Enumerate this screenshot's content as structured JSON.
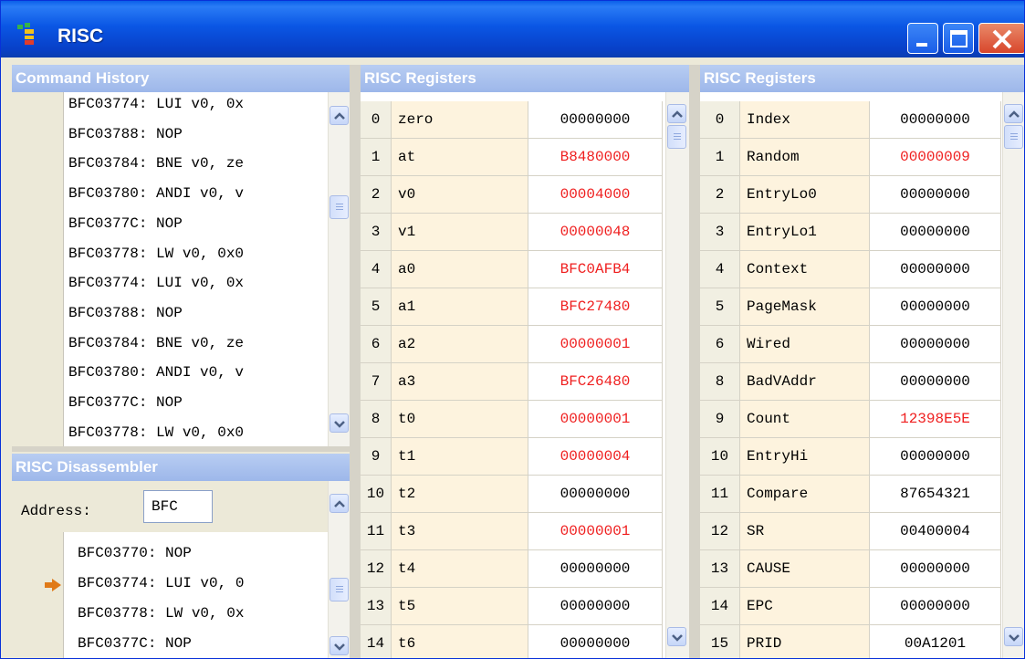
{
  "window": {
    "title": "RISC"
  },
  "command_history": {
    "title": "Command History",
    "lines": [
      "BFC03774: LUI v0, 0x",
      "BFC03788: NOP",
      "BFC03784: BNE v0, ze",
      "BFC03780: ANDI v0, v",
      "BFC0377C: NOP",
      "BFC03778: LW v0, 0x0",
      "BFC03774: LUI v0, 0x",
      "BFC03788: NOP",
      "BFC03784: BNE v0, ze",
      "BFC03780: ANDI v0, v",
      "BFC0377C: NOP",
      "BFC03778: LW v0, 0x0"
    ]
  },
  "disassembler": {
    "title": "RISC Disassembler",
    "address_label": "Address:",
    "address_value": "BFC",
    "current_line_index": 1,
    "lines": [
      "BFC03770: NOP",
      "BFC03774: LUI v0, 0",
      "BFC03778: LW v0, 0x",
      "BFC0377C: NOP"
    ]
  },
  "gpr_panel": {
    "title": "RISC Registers",
    "rows": [
      {
        "idx": "0",
        "name": "zero",
        "value": "00000000",
        "changed": false
      },
      {
        "idx": "1",
        "name": "at",
        "value": "B8480000",
        "changed": true
      },
      {
        "idx": "2",
        "name": "v0",
        "value": "00004000",
        "changed": true
      },
      {
        "idx": "3",
        "name": "v1",
        "value": "00000048",
        "changed": true
      },
      {
        "idx": "4",
        "name": "a0",
        "value": "BFC0AFB4",
        "changed": true
      },
      {
        "idx": "5",
        "name": "a1",
        "value": "BFC27480",
        "changed": true
      },
      {
        "idx": "6",
        "name": "a2",
        "value": "00000001",
        "changed": true
      },
      {
        "idx": "7",
        "name": "a3",
        "value": "BFC26480",
        "changed": true
      },
      {
        "idx": "8",
        "name": "t0",
        "value": "00000001",
        "changed": true
      },
      {
        "idx": "9",
        "name": "t1",
        "value": "00000004",
        "changed": true
      },
      {
        "idx": "10",
        "name": "t2",
        "value": "00000000",
        "changed": false
      },
      {
        "idx": "11",
        "name": "t3",
        "value": "00000001",
        "changed": true
      },
      {
        "idx": "12",
        "name": "t4",
        "value": "00000000",
        "changed": false
      },
      {
        "idx": "13",
        "name": "t5",
        "value": "00000000",
        "changed": false
      },
      {
        "idx": "14",
        "name": "t6",
        "value": "00000000",
        "changed": false
      }
    ]
  },
  "cp0_panel": {
    "title": "RISC Registers",
    "rows": [
      {
        "idx": "0",
        "name": "Index",
        "value": "00000000",
        "changed": false
      },
      {
        "idx": "1",
        "name": "Random",
        "value": "00000009",
        "changed": true
      },
      {
        "idx": "2",
        "name": "EntryLo0",
        "value": "00000000",
        "changed": false
      },
      {
        "idx": "3",
        "name": "EntryLo1",
        "value": "00000000",
        "changed": false
      },
      {
        "idx": "4",
        "name": "Context",
        "value": "00000000",
        "changed": false
      },
      {
        "idx": "5",
        "name": "PageMask",
        "value": "00000000",
        "changed": false
      },
      {
        "idx": "6",
        "name": "Wired",
        "value": "00000000",
        "changed": false
      },
      {
        "idx": "8",
        "name": "BadVAddr",
        "value": "00000000",
        "changed": false
      },
      {
        "idx": "9",
        "name": "Count",
        "value": "12398E5E",
        "changed": true
      },
      {
        "idx": "10",
        "name": "EntryHi",
        "value": "00000000",
        "changed": false
      },
      {
        "idx": "11",
        "name": "Compare",
        "value": "87654321",
        "changed": false
      },
      {
        "idx": "12",
        "name": "SR",
        "value": "00400004",
        "changed": false
      },
      {
        "idx": "13",
        "name": "CAUSE",
        "value": "00000000",
        "changed": false
      },
      {
        "idx": "14",
        "name": "EPC",
        "value": "00000000",
        "changed": false
      },
      {
        "idx": "15",
        "name": "PRID",
        "value": "00A1201",
        "changed": false
      }
    ]
  },
  "colors": {
    "changed_value": "#ef1f1f",
    "title_bar": "#0a56e4",
    "pane_header": "#9db7ea"
  }
}
